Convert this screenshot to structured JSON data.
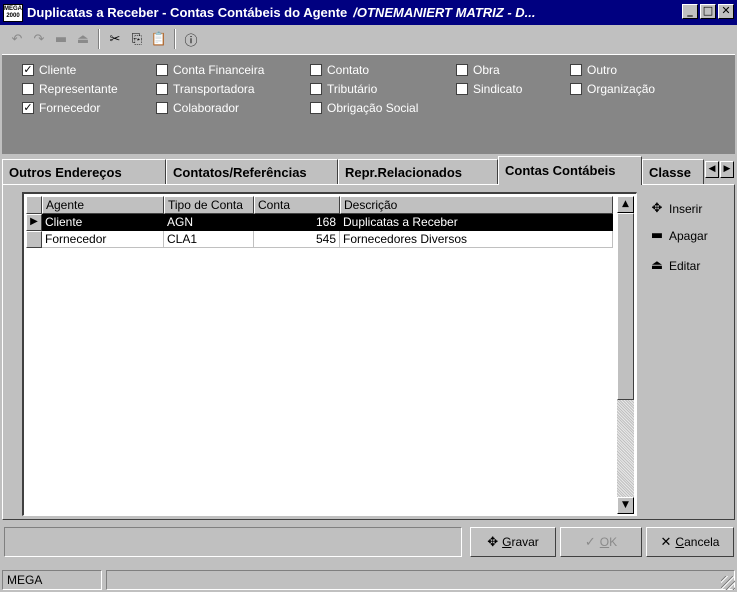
{
  "window": {
    "title": "Duplicatas a Receber -  Contas Contábeis do Agente",
    "title_italic": "/OTNEMANIERT MATRIZ - D...",
    "icon_text": "MEGA 2000",
    "buttons": [
      "minimize",
      "maximize",
      "close"
    ]
  },
  "toolbar": {
    "items": [
      {
        "name": "undo-icon",
        "glyph": "↶",
        "enabled": false
      },
      {
        "name": "redo-icon",
        "glyph": "↷",
        "enabled": false
      },
      {
        "name": "delete-icon",
        "glyph": "▬",
        "enabled": false
      },
      {
        "name": "eject-icon",
        "glyph": "⏏",
        "enabled": false
      },
      {
        "name": "cut-icon",
        "glyph": "✂",
        "enabled": true
      },
      {
        "name": "copy-icon",
        "glyph": "⎘",
        "enabled": true
      },
      {
        "name": "paste-icon",
        "glyph": "📋",
        "enabled": true
      },
      {
        "name": "info-icon",
        "glyph": "ⓘ",
        "enabled": true
      }
    ]
  },
  "checkboxes": [
    {
      "label": "Cliente",
      "checked": true
    },
    {
      "label": "Representante",
      "checked": false
    },
    {
      "label": "Fornecedor",
      "checked": true
    },
    {
      "label": "Conta Financeira",
      "checked": false
    },
    {
      "label": "Transportadora",
      "checked": false
    },
    {
      "label": "Colaborador",
      "checked": false
    },
    {
      "label": "Contato",
      "checked": false
    },
    {
      "label": "Tributário",
      "checked": false
    },
    {
      "label": "Obrigação Social",
      "checked": false
    },
    {
      "label": "Obra",
      "checked": false
    },
    {
      "label": "Sindicato",
      "checked": false
    },
    {
      "label": "Outro",
      "checked": false
    },
    {
      "label": "Organização",
      "checked": false
    }
  ],
  "tabs": [
    {
      "label": "Outros Endereços",
      "active": false
    },
    {
      "label": "Contatos/Referências",
      "active": false
    },
    {
      "label": "Repr.Relacionados",
      "active": false
    },
    {
      "label": "Contas Contábeis",
      "active": true
    },
    {
      "label": "Classe",
      "active": false
    }
  ],
  "grid": {
    "columns": [
      "Agente",
      "Tipo de Conta",
      "Conta",
      "Descrição"
    ],
    "rows": [
      {
        "agente": "Cliente",
        "tipo": "AGN",
        "conta": "168",
        "descricao": "Duplicatas a Receber",
        "selected": true
      },
      {
        "agente": "Fornecedor",
        "tipo": "CLA1",
        "conta": "545",
        "descricao": "Fornecedores Diversos",
        "selected": false
      }
    ]
  },
  "side_actions": [
    {
      "label": "Inserir",
      "icon": "plus-icon"
    },
    {
      "label": "Apagar",
      "icon": "minus-icon"
    },
    {
      "label": "Editar",
      "icon": "edit-icon"
    }
  ],
  "bottom_buttons": {
    "save": {
      "prefix": "",
      "accel": "G",
      "rest": "ravar",
      "enabled": true
    },
    "ok": {
      "accel": "O",
      "rest": "K",
      "enabled": false
    },
    "cancel": {
      "accel": "C",
      "rest": "ancela",
      "enabled": true
    }
  },
  "status": {
    "company": "MEGA"
  }
}
